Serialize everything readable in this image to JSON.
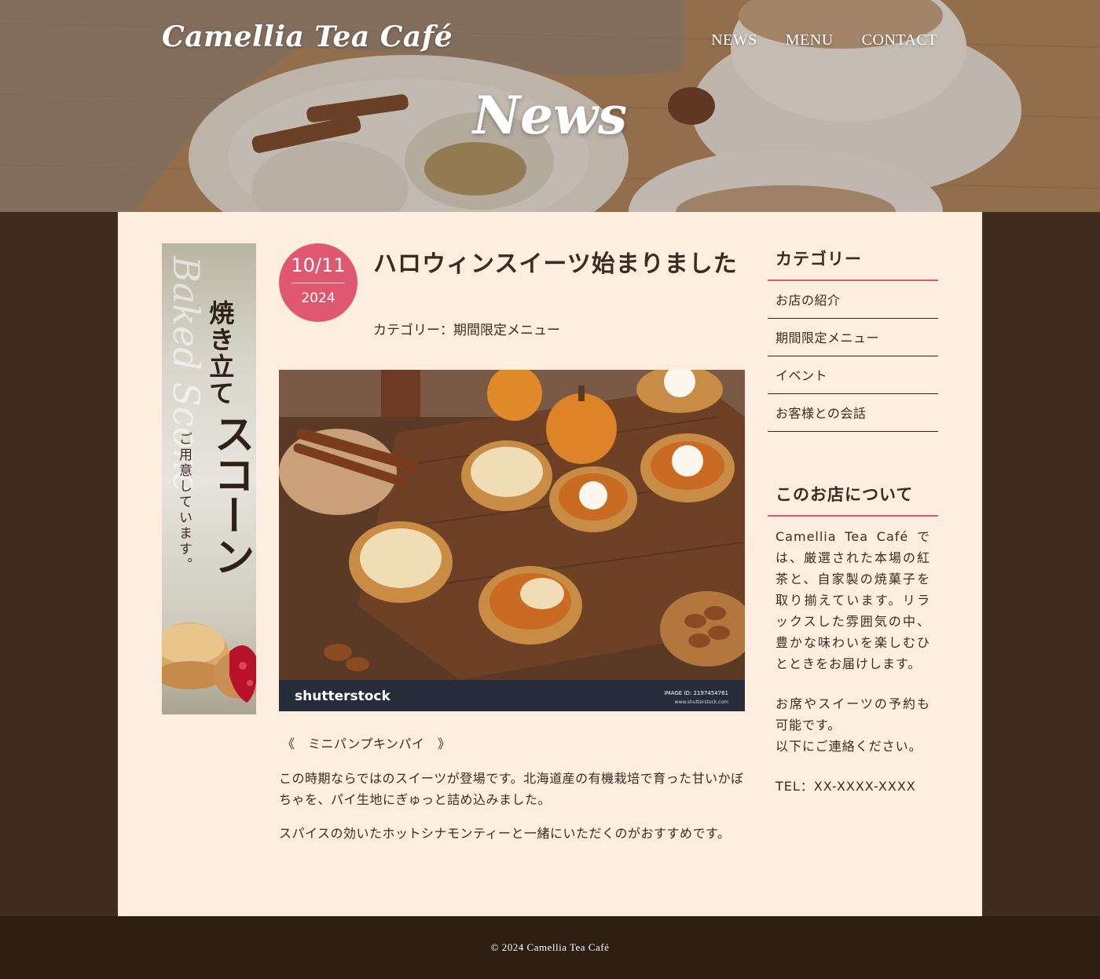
{
  "brand": {
    "logo": "Camellia Tea Café"
  },
  "nav": {
    "items": [
      "NEWS",
      "MENU",
      "CONTACT"
    ]
  },
  "hero": {
    "title": "News"
  },
  "banner": {
    "script": "Baked Scone",
    "line1": "焼き立て",
    "line2": "スコーン",
    "line3": "ご用意しています。"
  },
  "article": {
    "date_md": "10/11",
    "date_year": "2024",
    "title": "ハロウィンスイーツ始まりました",
    "category": "カテゴリー：期間限定メニュー",
    "image": {
      "watermark": "shutterstock",
      "image_id": "IMAGE ID: 2197454761",
      "site": "www.shutterstock.com"
    },
    "subtitle": "《　ミニパンプキンパイ　》",
    "paragraphs": [
      "この時期ならではのスイーツが登場です。北海道産の有機栽培で育った甘いかぼちゃを、パイ生地にぎゅっと詰め込みました。",
      "スパイスの効いたホットシナモンティーと一緒にいただくのがおすすめです。"
    ]
  },
  "sidebar": {
    "categories_heading": "カテゴリー",
    "categories": [
      "お店の紹介",
      "期間限定メニュー",
      "イベント",
      "お客様との会話"
    ],
    "about_heading": "このお店について",
    "about_paragraphs": [
      "Camellia Tea Café では、厳選された本場の紅茶と、自家製の焼菓子を取り揃えています。リラックスした雰囲気の中、豊かな味わいを楽しむひとときをお届けします。",
      "お席やスイーツの予約も可能です。\n以下にご連絡ください。",
      "TEL：XX-XXXX-XXXX"
    ]
  },
  "footer": {
    "copyright": "© 2024 Camellia Tea Café"
  },
  "colors": {
    "accent": "#e05870",
    "panel_bg": "#feeee0",
    "page_bg": "#3e2c1e",
    "footer_bg": "#2e1f13",
    "text": "#3a2c22"
  }
}
